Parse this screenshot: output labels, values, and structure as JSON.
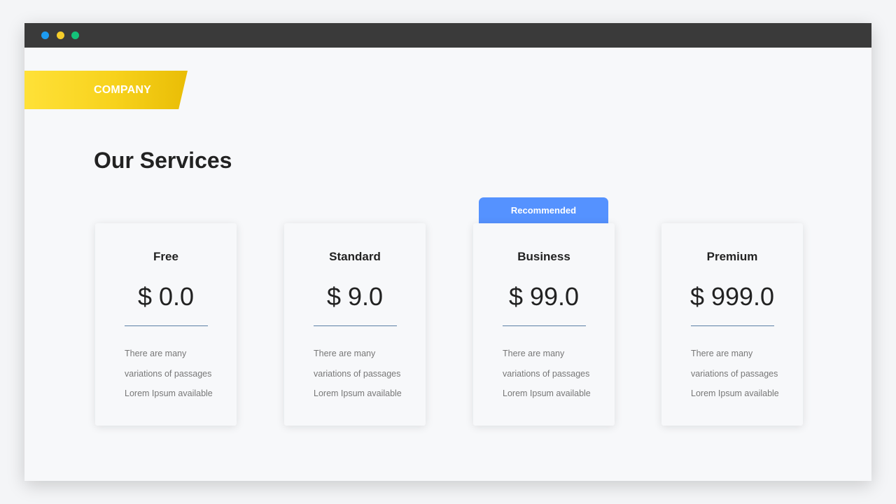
{
  "window": {
    "controls": [
      {
        "name": "blue-dot",
        "color": "#1d9bf0"
      },
      {
        "name": "yellow-dot",
        "color": "#f5cd2a"
      },
      {
        "name": "green-dot",
        "color": "#14c37a"
      }
    ]
  },
  "banner": {
    "label": "COMPANY",
    "color": "#f7d21c"
  },
  "page": {
    "title": "Our Services"
  },
  "ribbon": {
    "label": "Recommended",
    "color": "#5592ff"
  },
  "plans": [
    {
      "name": "Free",
      "price": "$ 0.0",
      "desc": [
        "There are many",
        "variations of passages",
        "Lorem Ipsum available"
      ]
    },
    {
      "name": "Standard",
      "price": "$ 9.0",
      "desc": [
        "There are many",
        "variations of passages",
        "Lorem Ipsum available"
      ]
    },
    {
      "name": "Business",
      "price": "$ 99.0",
      "desc": [
        "There are many",
        "variations of passages",
        "Lorem Ipsum available"
      ]
    },
    {
      "name": "Premium",
      "price": "$ 999.0",
      "desc": [
        "There are many",
        "variations of passages",
        "Lorem Ipsum available"
      ]
    }
  ]
}
